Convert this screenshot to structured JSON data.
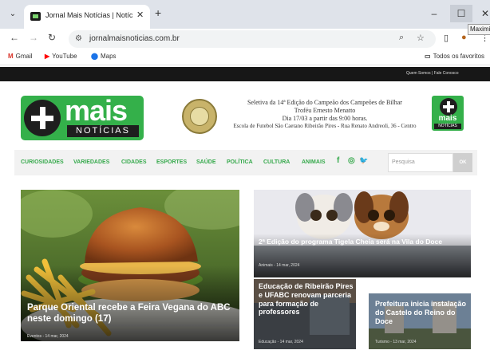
{
  "browser": {
    "tab_title": "Jornal Mais Notícias | Notícias",
    "new_tab_label": "+",
    "tab_close": "✕",
    "tooltip": "Maximizar",
    "url": "jornalmaisnoticias.com.br",
    "window": {
      "minimize": "–",
      "maximize": "☐",
      "close": "✕"
    }
  },
  "bookmarks": {
    "items": [
      {
        "icon": "M",
        "label": "Gmail",
        "color": "#d93025"
      },
      {
        "icon": "▶",
        "label": "YouTube",
        "color": "#ff0000"
      },
      {
        "icon": "⬤",
        "label": "Maps",
        "color": "#1a73e8"
      }
    ],
    "all_label": "Todos os favoritos"
  },
  "site": {
    "top_links": "Quem Somos | Fale Conosco",
    "logo": {
      "word": "mais",
      "sub": "NOTÍCIAS"
    },
    "banner": {
      "line1": "Seletiva da 14ª Edição do Campeão dos Campeões de Bilhar",
      "line2": "Troféu Ernesto Menatto",
      "line3": "Dia 17/03 a partir das 9:00 horas.",
      "line4": "Escola de Futebol São Caetano Ribeirão Pires - Rua Renato Andreoli, 36 - Centro"
    },
    "menu": [
      "CURIOSIDADES",
      "VARIEDADES",
      "CIDADES",
      "ESPORTES",
      "SAÚDE",
      "POLÍTICA",
      "CULTURA",
      "ANIMAIS"
    ],
    "social": [
      "f",
      "◎",
      "🐦"
    ],
    "search_placeholder": "Pesquisa",
    "search_button": "OK",
    "accent_color": "#36a94c"
  },
  "articles": [
    {
      "title": "Parque Oriental recebe a Feira Vegana do ABC neste domingo (17)",
      "meta": "Eventos - 14 mar, 2024"
    },
    {
      "title": "2ª Edição do programa Tigela Cheia será na Vila do Doce",
      "meta": "Animais - 14 mar, 2024"
    },
    {
      "title": "Educação de Ribeirão Pires e UFABC renovam parceria para formação de professores",
      "meta": "Educação - 14 mar, 2024"
    },
    {
      "title": "Prefeitura inicia instalação do Castelo do Reino do Doce",
      "meta": "Turismo - 13 mar, 2024"
    }
  ]
}
